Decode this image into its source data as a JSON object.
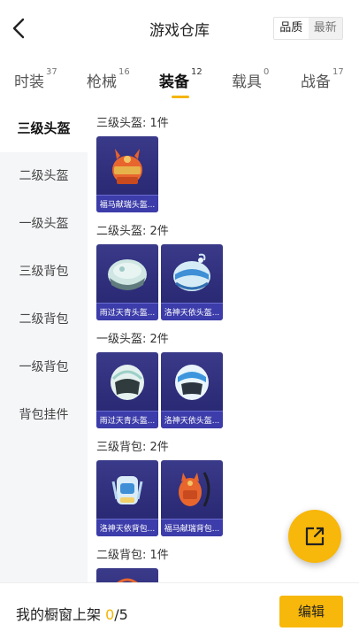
{
  "header": {
    "title": "游戏仓库",
    "sort_options": [
      "品质",
      "最新"
    ],
    "back_icon": "chevron-left-icon"
  },
  "tabs": [
    {
      "label": "时装",
      "count": "37"
    },
    {
      "label": "枪械",
      "count": "16"
    },
    {
      "label": "装备",
      "count": "12",
      "active": true
    },
    {
      "label": "载具",
      "count": "0"
    },
    {
      "label": "战备",
      "count": "17"
    }
  ],
  "sidebar": {
    "items": [
      {
        "label": "三级头盔",
        "active": true
      },
      {
        "label": "二级头盔"
      },
      {
        "label": "一级头盔"
      },
      {
        "label": "三级背包"
      },
      {
        "label": "二级背包"
      },
      {
        "label": "一级背包"
      },
      {
        "label": "背包挂件"
      }
    ]
  },
  "sections": [
    {
      "title": "三级头盔: 1件",
      "items": [
        {
          "name": "福马献瑞头盔..."
        }
      ]
    },
    {
      "title": "二级头盔: 2件",
      "items": [
        {
          "name": "雨过天青头盔..."
        },
        {
          "name": "洛神天依头盔..."
        }
      ]
    },
    {
      "title": "一级头盔: 2件",
      "items": [
        {
          "name": "雨过天青头盔..."
        },
        {
          "name": "洛神天依头盔..."
        }
      ]
    },
    {
      "title": "三级背包: 2件",
      "items": [
        {
          "name": "洛神天依背包..."
        },
        {
          "name": "福马献瑞背包..."
        }
      ]
    },
    {
      "title": "二级背包: 1件",
      "items": []
    }
  ],
  "footer": {
    "label": "我的橱窗上架 ",
    "count_current": "0",
    "count_total": "/5",
    "edit_label": "编辑"
  },
  "fab": {
    "icon": "share-external-icon"
  },
  "colors": {
    "accent": "#f7b70b",
    "card_bg": "#2c2c78",
    "sidebar_bg": "#f5f6f8"
  }
}
